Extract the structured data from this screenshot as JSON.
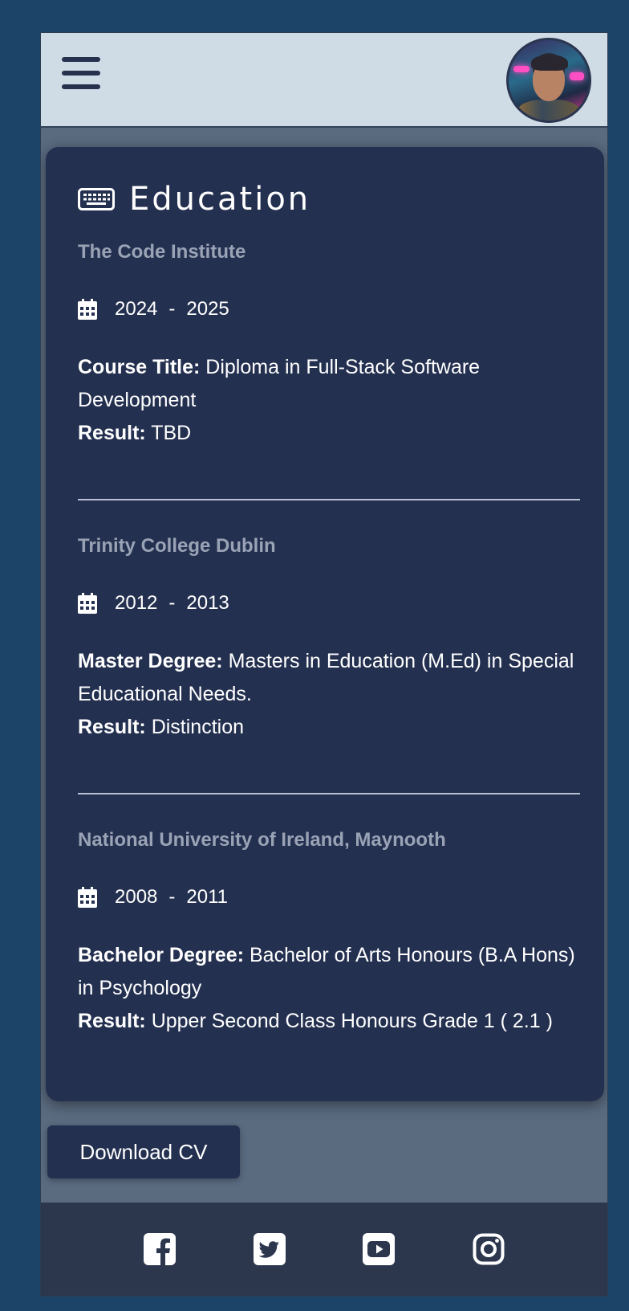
{
  "header": {
    "menu_icon": "hamburger-menu-icon",
    "avatar_icon": "profile-avatar"
  },
  "education": {
    "title": "Education",
    "title_icon": "keyboard-icon",
    "entries": [
      {
        "institution": "The Code Institute",
        "start": "2024",
        "end": "2025",
        "separator": "-",
        "detail_label": "Course Title:",
        "detail_value": "Diploma in Full-Stack Software Development",
        "result_label": "Result:",
        "result_value": "TBD"
      },
      {
        "institution": "Trinity College Dublin",
        "start": "2012",
        "end": "2013",
        "separator": "-",
        "detail_label": "Master Degree:",
        "detail_value": "Masters in Education (M.Ed) in Special Educational Needs.",
        "result_label": "Result:",
        "result_value": "Distinction"
      },
      {
        "institution": "National University of Ireland, Maynooth",
        "start": "2008",
        "end": "2011",
        "separator": "-",
        "detail_label": "Bachelor Degree:",
        "detail_value": "Bachelor of Arts Honours (B.A Hons) in Psychology",
        "result_label": "Result:",
        "result_value": "Upper Second Class Honours Grade 1 ( 2.1 )"
      }
    ]
  },
  "actions": {
    "download_label": "Download CV"
  },
  "footer": {
    "links": [
      {
        "icon": "facebook-icon"
      },
      {
        "icon": "twitter-icon"
      },
      {
        "icon": "youtube-icon"
      },
      {
        "icon": "instagram-icon"
      }
    ]
  },
  "colors": {
    "page_bg": "#1b4468",
    "card_bg": "#243050",
    "topbar_bg": "#cfdbe5",
    "institution_text": "#9aa3b5",
    "footer_bg": "#2c374e"
  }
}
